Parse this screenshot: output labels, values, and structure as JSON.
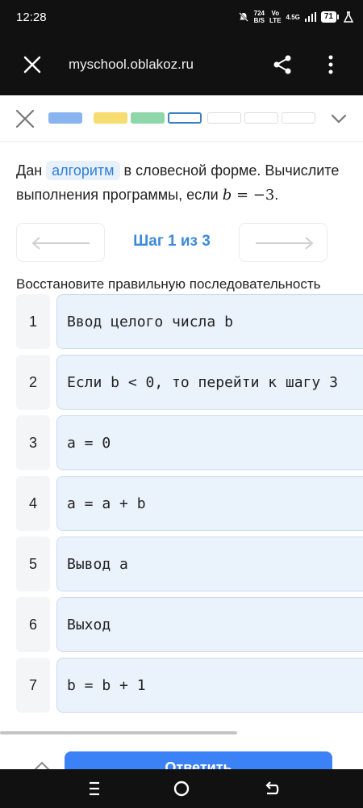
{
  "status_bar": {
    "time": "12:28",
    "net_speed_value": "724",
    "net_speed_unit": "B/S",
    "volte_top": "Vo",
    "volte_bottom": "LTE",
    "signal_label": "4.5G",
    "battery": "71"
  },
  "browser": {
    "url": "myschool.oblakoz.ru"
  },
  "progress": {
    "segments": [
      {
        "state": "done-blue",
        "color": "#8ab4f0"
      },
      {
        "state": "done-yellow",
        "color": "#f7dc6f"
      },
      {
        "state": "done-green",
        "color": "#8fd6a8"
      },
      {
        "state": "current",
        "color": "#3b82c4"
      },
      {
        "state": "empty",
        "color": "#dddddd"
      },
      {
        "state": "empty",
        "color": "#dddddd"
      },
      {
        "state": "empty",
        "color": "#dddddd"
      }
    ]
  },
  "question": {
    "part1": "Дан ",
    "chip": "алгоритм",
    "part2": " в словесной форме. Вычислите",
    "line2_text": "выполнения программы, если ",
    "var": "b",
    "eq": " = −3",
    "dot": "."
  },
  "step_nav": {
    "label": "Шаг 1 из 3"
  },
  "instruction": "Восстановите правильную последовательность",
  "steps": [
    {
      "num": "1",
      "text": "Ввод целого числа b"
    },
    {
      "num": "2",
      "text": "Если b < 0, то перейти к шагу 3"
    },
    {
      "num": "3",
      "text": "a = 0"
    },
    {
      "num": "4",
      "text": "a = a + b"
    },
    {
      "num": "5",
      "text": "Вывод a"
    },
    {
      "num": "6",
      "text": "Выход"
    },
    {
      "num": "7",
      "text": "b = b + 1"
    }
  ],
  "answer_button": "Ответить",
  "colors": {
    "accent": "#3b82f6",
    "step_card_bg": "#eaf2fc",
    "chip_text": "#2f7fd6"
  }
}
